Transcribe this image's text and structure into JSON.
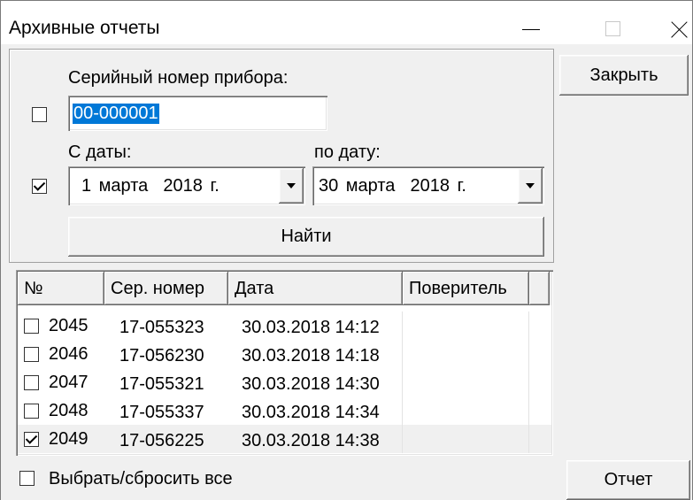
{
  "window": {
    "title": "Архивные отчеты",
    "icons": {
      "minimize": "minimize-icon",
      "maximize": "maximize-icon",
      "close": "close-icon"
    }
  },
  "filter": {
    "serial": {
      "enabled": false,
      "label": "Серийный номер прибора:",
      "value": "00-000001",
      "value_selected": true
    },
    "dates": {
      "enabled": true,
      "from_label": "С даты:",
      "to_label": "по дату:",
      "from": "1 марта  2018 г.",
      "to": "30 марта  2018 г.",
      "dropdown_icon": "dropdown-arrow-icon"
    },
    "search_label": "Найти"
  },
  "buttons": {
    "close": "Закрыть",
    "report": "Отчет"
  },
  "table": {
    "columns": [
      "№",
      "Сер. номер",
      "Дата",
      "Поверитель",
      ""
    ],
    "rows": [
      {
        "checked": false,
        "selected": false,
        "number": "2045",
        "serial": "17-055323",
        "date": "30.03.2018 14:12",
        "verifier": ""
      },
      {
        "checked": false,
        "selected": false,
        "number": "2046",
        "serial": "17-056230",
        "date": "30.03.2018 14:18",
        "verifier": ""
      },
      {
        "checked": false,
        "selected": false,
        "number": "2047",
        "serial": "17-055321",
        "date": "30.03.2018 14:30",
        "verifier": ""
      },
      {
        "checked": false,
        "selected": false,
        "number": "2048",
        "serial": "17-055337",
        "date": "30.03.2018 14:34",
        "verifier": ""
      },
      {
        "checked": true,
        "selected": true,
        "number": "2049",
        "serial": "17-056225",
        "date": "30.03.2018 14:38",
        "verifier": ""
      }
    ]
  },
  "select_all": {
    "label": "Выбрать/сбросить все",
    "checked": false
  },
  "colors": {
    "selection": "#0078d7",
    "window_bg": "#f0f0f0",
    "title_bar_bg": "#ffffff",
    "list_bg": "#ffffff"
  }
}
